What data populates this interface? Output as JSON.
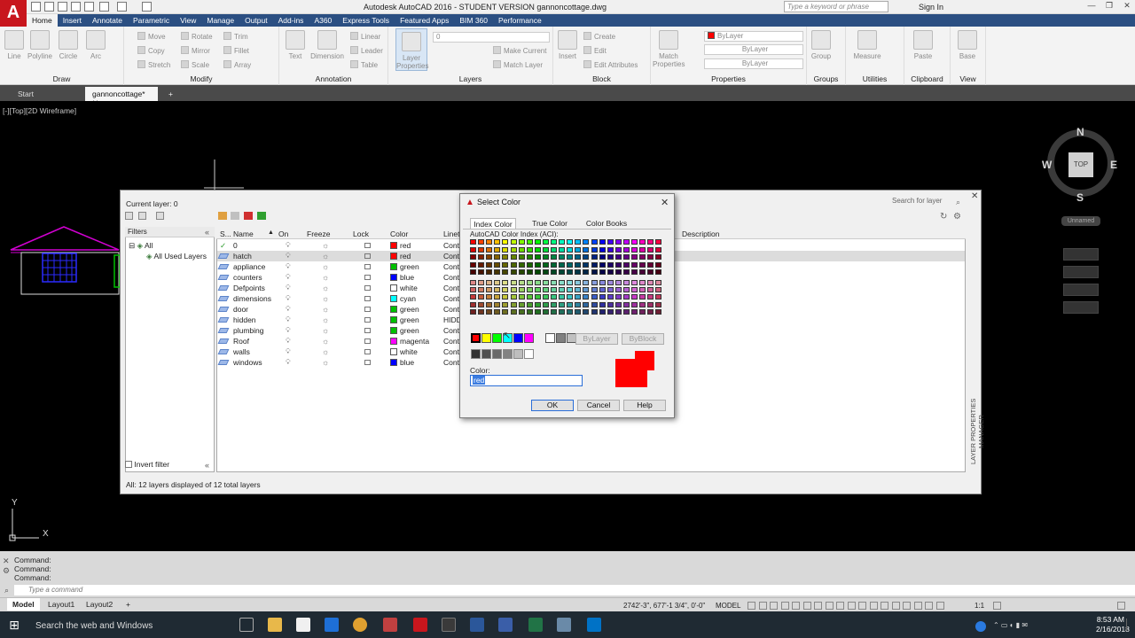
{
  "app": {
    "title": "Autodesk AutoCAD 2016 - STUDENT VERSION    gannoncottage.dwg",
    "search_placeholder": "Type a keyword or phrase",
    "sign_in": "Sign In"
  },
  "menu_tabs": [
    "Home",
    "Insert",
    "Annotate",
    "Parametric",
    "View",
    "Manage",
    "Output",
    "Add-ins",
    "A360",
    "Express Tools",
    "Featured Apps",
    "BIM 360",
    "Performance"
  ],
  "ribbon": {
    "draw": {
      "label": "Draw",
      "tools": [
        "Line",
        "Polyline",
        "Circle",
        "Arc"
      ]
    },
    "modify": {
      "label": "Modify",
      "tools": [
        "Move",
        "Rotate",
        "Trim",
        "Copy",
        "Mirror",
        "Fillet",
        "Stretch",
        "Scale",
        "Array"
      ]
    },
    "annotation": {
      "label": "Annotation",
      "tools": [
        "Text",
        "Dimension",
        "Linear",
        "Leader",
        "Table"
      ]
    },
    "layers": {
      "label": "Layers",
      "tools": [
        "Layer Properties"
      ],
      "current": "0"
    },
    "block": {
      "label": "Block",
      "tools": [
        "Insert",
        "Create",
        "Edit",
        "Edit Attributes"
      ]
    },
    "layer_state": {
      "tools": [
        "Make Current",
        "Match Layer"
      ]
    },
    "properties": {
      "label": "Properties",
      "tools": [
        "Match Properties"
      ],
      "values": [
        "ByLayer",
        "ByLayer",
        "ByLayer"
      ]
    },
    "groups": {
      "label": "Groups",
      "tools": [
        "Group"
      ]
    },
    "utilities": {
      "label": "Utilities",
      "tools": [
        "Measure"
      ]
    },
    "clipboard": {
      "label": "Clipboard",
      "tools": [
        "Paste"
      ]
    },
    "view": {
      "label": "View",
      "tools": [
        "Base"
      ]
    }
  },
  "file_tabs": {
    "start": "Start",
    "active": "gannoncottage*"
  },
  "viewport_label": "[-][Top][2D Wireframe]",
  "viewcube": {
    "n": "N",
    "s": "S",
    "e": "E",
    "w": "W",
    "top": "TOP",
    "ucs": "Unnamed"
  },
  "ucs": {
    "x": "X",
    "y": "Y"
  },
  "layer_manager": {
    "current_layer": "Current layer: 0",
    "search_placeholder": "Search for layer",
    "filters_title": "Filters",
    "filter_tree": [
      "All",
      "All Used Layers"
    ],
    "columns": [
      "S...",
      "Name",
      "On",
      "Freeze",
      "Lock",
      "Color",
      "Linet",
      "Description"
    ],
    "layers": [
      {
        "name": "0",
        "color": "red",
        "hex": "#ff0000",
        "linetype": "Conti",
        "current": true
      },
      {
        "name": "hatch",
        "color": "red",
        "hex": "#ff0000",
        "linetype": "Conti",
        "selected": true
      },
      {
        "name": "appliance",
        "color": "green",
        "hex": "#00c000",
        "linetype": "Conti"
      },
      {
        "name": "counters",
        "color": "blue",
        "hex": "#0000ff",
        "linetype": "Conti"
      },
      {
        "name": "Defpoints",
        "color": "white",
        "hex": "#ffffff",
        "linetype": "Conti"
      },
      {
        "name": "dimensions",
        "color": "cyan",
        "hex": "#00ffff",
        "linetype": "Conti"
      },
      {
        "name": "door",
        "color": "green",
        "hex": "#00c000",
        "linetype": "Conti"
      },
      {
        "name": "hidden",
        "color": "green",
        "hex": "#00c000",
        "linetype": "HIDD"
      },
      {
        "name": "plumbing",
        "color": "green",
        "hex": "#00c000",
        "linetype": "Conti"
      },
      {
        "name": "Roof",
        "color": "magenta",
        "hex": "#ff00ff",
        "linetype": "Conti"
      },
      {
        "name": "walls",
        "color": "white",
        "hex": "#ffffff",
        "linetype": "Conti"
      },
      {
        "name": "windows",
        "color": "blue",
        "hex": "#0000ff",
        "linetype": "Conti"
      }
    ],
    "invert_filter": "Invert filter",
    "status": "All: 12 layers displayed of 12 total layers",
    "side_title": "LAYER PROPERTIES MANAGER"
  },
  "select_color": {
    "title": "Select Color",
    "tabs": [
      "Index Color",
      "True Color",
      "Color Books"
    ],
    "aci_label": "AutoCAD Color Index (ACI):",
    "bylayer": "ByLayer",
    "byblock": "ByBlock",
    "color_label": "Color:",
    "color_value": "red",
    "ok": "OK",
    "cancel": "Cancel",
    "help": "Help",
    "standard_colors": [
      "#ff0000",
      "#ffff00",
      "#00ff00",
      "#00ffff",
      "#0000ff",
      "#ff00ff",
      "#ffffff",
      "#808080",
      "#c0c0c0"
    ],
    "gray_colors": [
      "#333333",
      "#505050",
      "#696969",
      "#828282",
      "#bebebe",
      "#ffffff"
    ]
  },
  "command": {
    "history": [
      "Command:",
      "Command:",
      "Command:"
    ],
    "placeholder": "Type a command"
  },
  "layout_tabs": [
    "Model",
    "Layout1",
    "Layout2"
  ],
  "status_bar": {
    "coords": "2742'-3\", 677'-1 3/4\", 0'-0\"",
    "model": "MODEL",
    "scale": "1:1"
  },
  "taskbar": {
    "search": "Search the web and Windows",
    "time": "8:53 AM",
    "date": "2/16/2018"
  }
}
